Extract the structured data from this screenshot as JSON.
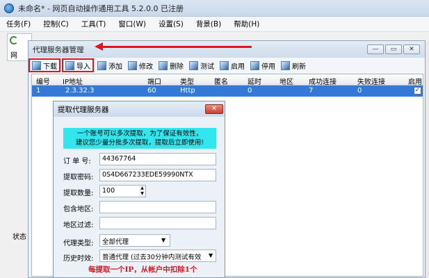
{
  "main": {
    "title": "未命名* - 网页自动操作通用工具 5.2.0.0 已注册",
    "menu": [
      "任务(F)",
      "控制(C)",
      "工具(T)",
      "窗口(W)",
      "设置(S)",
      "背景(B)",
      "帮助(H)"
    ],
    "side_label": "网",
    "status_label": "状态"
  },
  "proxy_manager": {
    "title": "代理服务器管理",
    "window_buttons": [
      "—",
      "▭",
      "✕"
    ],
    "toolbar": [
      {
        "label": "下载",
        "highlighted": true
      },
      {
        "label": "导入",
        "highlighted": true
      },
      {
        "label": "添加",
        "highlighted": false
      },
      {
        "label": "修改",
        "highlighted": false
      },
      {
        "label": "删除",
        "highlighted": false
      },
      {
        "label": "测试",
        "highlighted": false
      },
      {
        "label": "启用",
        "highlighted": false
      },
      {
        "label": "停用",
        "highlighted": false
      },
      {
        "label": "刷新",
        "highlighted": false
      }
    ],
    "columns": [
      "编号",
      "IP地址",
      "端口",
      "类型",
      "匿名",
      "延时",
      "地区",
      "成功连接",
      "失败连接",
      "启用"
    ],
    "rows": [
      {
        "id": "1",
        "ip": "2.3.32.3",
        "port": "60",
        "type": "Http",
        "anon": "",
        "delay": "0",
        "region": "",
        "success": "7",
        "fail": "0",
        "enabled": true
      }
    ]
  },
  "dialog": {
    "title": "提取代理服务器",
    "close": "✕",
    "notice_line1": "一个账号可以多次提取，为了保证有效性，",
    "notice_line2": "建议您少量分批多次提取，提取后立即使用!",
    "order_label": "订 单 号:",
    "order_value": "44367764",
    "password_label": "提取密码:",
    "password_value": "0S4D667233EDE59990NTX",
    "count_label": "提取数量:",
    "count_value": "100",
    "include_label": "包含地区:",
    "include_value": "",
    "filter_label": "地区过滤:",
    "filter_value": "",
    "type_label": "代理类型:",
    "type_value": "全部代理",
    "history_label": "历史时效:",
    "history_value": "普通代理 (过去30分钟内测试有效",
    "warning": "每提取一个IP，从帐户中扣除1个"
  },
  "colors": {
    "selected_row": "#3579d6",
    "notice_bg": "#33e6ee",
    "highlight_red": "#e0141e"
  }
}
